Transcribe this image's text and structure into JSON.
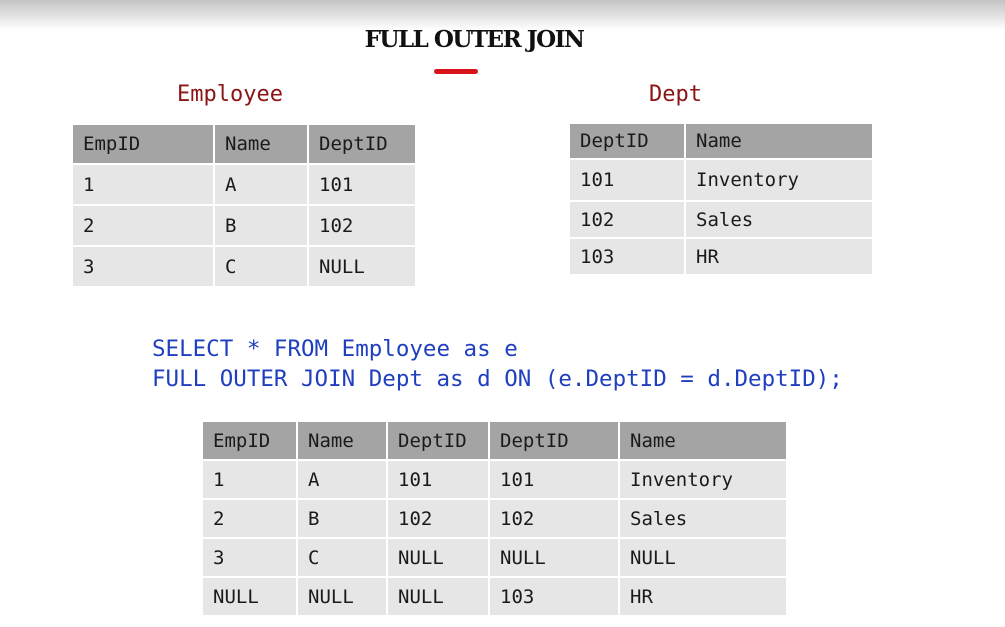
{
  "title": "FULL OUTER JOIN",
  "colors": {
    "caption": "#8b1414",
    "sql": "#1f3fbf",
    "header_bg": "#a4a4a4",
    "cell_bg": "#e6e6e6",
    "underline": "#d8141a"
  },
  "employee": {
    "caption": "Employee",
    "columns": [
      "EmpID",
      "Name",
      "DeptID"
    ],
    "rows": [
      [
        "1",
        "A",
        "101"
      ],
      [
        "2",
        "B",
        "102"
      ],
      [
        "3",
        "C",
        "NULL"
      ]
    ]
  },
  "dept": {
    "caption": "Dept",
    "columns": [
      "DeptID",
      "Name"
    ],
    "rows": [
      [
        "101",
        "Inventory"
      ],
      [
        "102",
        "Sales"
      ],
      [
        "103",
        "HR"
      ]
    ]
  },
  "query": {
    "line1": "SELECT * FROM Employee as e",
    "line2": "FULL OUTER JOIN Dept as d ON (e.DeptID = d.DeptID);"
  },
  "result": {
    "columns": [
      "EmpID",
      "Name",
      "DeptID",
      "DeptID",
      "Name"
    ],
    "rows": [
      [
        "1",
        "A",
        "101",
        "101",
        "Inventory"
      ],
      [
        "2",
        "B",
        "102",
        "102",
        "Sales"
      ],
      [
        "3",
        "C",
        "NULL",
        "NULL",
        "NULL"
      ],
      [
        "NULL",
        "NULL",
        "NULL",
        "103",
        "HR"
      ]
    ]
  }
}
